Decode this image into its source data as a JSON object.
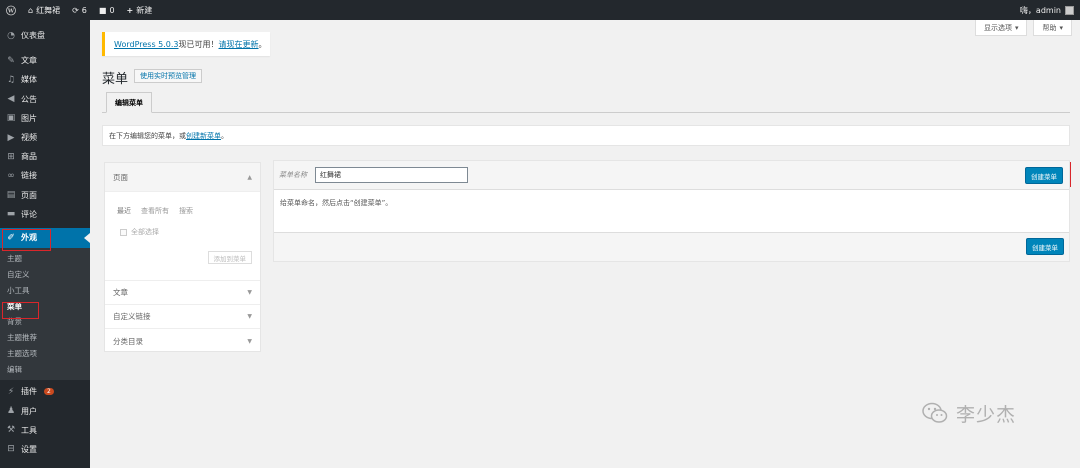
{
  "adminbar": {
    "site_name": "红舞裙",
    "updates_count": "6",
    "comments_count": "0",
    "new_label": "新建",
    "greeting": "嗨，admin"
  },
  "sidebar": {
    "items": [
      {
        "label": "仪表盘",
        "icon": "dashboard-icon"
      },
      {
        "label": "文章",
        "icon": "pin-icon"
      },
      {
        "label": "媒体",
        "icon": "media-icon"
      },
      {
        "label": "公告",
        "icon": "megaphone-icon"
      },
      {
        "label": "图片",
        "icon": "image-icon"
      },
      {
        "label": "视频",
        "icon": "video-icon"
      },
      {
        "label": "商品",
        "icon": "cart-icon"
      },
      {
        "label": "链接",
        "icon": "link-icon"
      },
      {
        "label": "页面",
        "icon": "page-icon"
      },
      {
        "label": "评论",
        "icon": "comment-icon"
      },
      {
        "label": "外观",
        "icon": "brush-icon"
      }
    ],
    "submenu": [
      "主题",
      "自定义",
      "小工具",
      "菜单",
      "背景",
      "主题推荐",
      "主题选项",
      "编辑"
    ],
    "bottom_items": [
      {
        "label": "插件",
        "icon": "plugin-icon",
        "badge": "2"
      },
      {
        "label": "用户",
        "icon": "user-icon"
      },
      {
        "label": "工具",
        "icon": "wrench-icon"
      },
      {
        "label": "设置",
        "icon": "settings-icon"
      }
    ]
  },
  "screen_options": {
    "options_label": "显示选项",
    "help_label": "帮助"
  },
  "notice": {
    "version_link": "WordPress 5.0.3",
    "middle_text": "现已可用！",
    "update_link": "请现在更新",
    "end": "。"
  },
  "page": {
    "title": "菜单",
    "live_preview_button": "使用实时预览管理",
    "tab_edit_menus": "编辑菜单",
    "manage_text": "在下方编辑您的菜单，或",
    "manage_link": "创建新菜单",
    "manage_end": "。"
  },
  "accordion": {
    "pages_title": "页面",
    "tab_recent": "最近",
    "tab_all": "查看所有",
    "tab_search": "搜索",
    "select_all": "全部选择",
    "add_to_menu": "添加到菜单",
    "posts_title": "文章",
    "custom_links_title": "自定义链接",
    "categories_title": "分类目录"
  },
  "menu_panel": {
    "name_label": "菜单名称",
    "name_value": "红舞裙",
    "create_button": "创建菜单",
    "instructions": "给菜单命名，然后点击“创建菜单”。",
    "create_button_footer": "创建菜单"
  },
  "watermark": {
    "text": "李少杰"
  }
}
